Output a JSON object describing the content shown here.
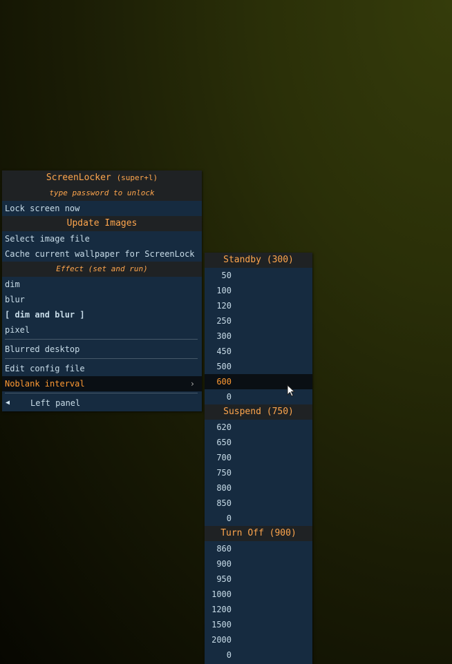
{
  "main_menu": {
    "title": "ScreenLocker",
    "title_hint": "(super+l)",
    "type_password": "type password to unlock",
    "lock_now": "Lock screen now",
    "update_images": "Update Images",
    "select_image": "Select image file",
    "cache_wallpaper": "Cache current wallpaper for ScreenLock",
    "effect_header": "Effect (set and run)",
    "effects": [
      "dim",
      "blur",
      "[ dim and blur ]",
      "pixel"
    ],
    "blurred_desktop": "Blurred desktop",
    "edit_config": "Edit config file",
    "noblank_interval": "Noblank interval",
    "noblank_arrow": "›",
    "left_panel_icon": "◀",
    "left_panel": "Left panel"
  },
  "submenu": {
    "standby_title": "Standby (300)",
    "standby_values": [
      "50",
      "100",
      "120",
      "250",
      "300",
      "450",
      "500",
      "600",
      "0"
    ],
    "suspend_title": "Suspend (750)",
    "suspend_values": [
      "620",
      "650",
      "700",
      "750",
      "800",
      "850",
      "0"
    ],
    "turnoff_title": "Turn Off (900)",
    "turnoff_values": [
      "860",
      "900",
      "950",
      "1000",
      "1200",
      "1500",
      "2000",
      "0"
    ]
  },
  "colors": {
    "menu_bg": "#162b40",
    "header_bg": "#1f2224",
    "accent": "#ffa64d",
    "text": "#c8dce8",
    "highlight_bg": "#0a0f14"
  },
  "icons": {
    "cursor": "mouse-pointer-icon",
    "submenu_arrow": "chevron-right-icon",
    "left_panel": "triangle-left-icon"
  }
}
